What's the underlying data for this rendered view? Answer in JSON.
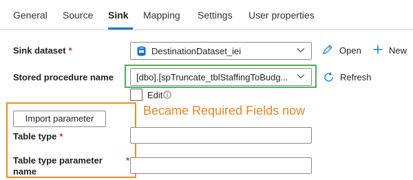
{
  "tabs": [
    {
      "label": "General"
    },
    {
      "label": "Source"
    },
    {
      "label": "Sink"
    },
    {
      "label": "Mapping"
    },
    {
      "label": "Settings"
    },
    {
      "label": "User properties"
    }
  ],
  "active_tab": "Sink",
  "sink_dataset": {
    "label": "Sink dataset",
    "required_mark": "*",
    "value": "DestinationDataset_iei",
    "open_label": "Open",
    "new_label": "New"
  },
  "stored_procedure": {
    "label": "Stored procedure name",
    "value": "[dbo].[spTruncate_tblStaffingToBudg...",
    "refresh_label": "Refresh"
  },
  "edit": {
    "label": "Edit",
    "checked": false
  },
  "annotation": {
    "text": "Became Required Fields now",
    "color": "#e8842a"
  },
  "import_parameter": {
    "label": "Import parameter"
  },
  "table_type": {
    "label": "Table type",
    "required_mark": "*",
    "value": ""
  },
  "table_type_parameter": {
    "label_line1": "Table type parameter",
    "label_line2": "name",
    "required_mark": "*",
    "value": ""
  },
  "colors": {
    "accent": "#0078d4",
    "highlight_green": "#4caf50",
    "highlight_orange": "#f08a24",
    "required": "#c4314b"
  },
  "icons": {
    "dataset": "sql-dataset-icon",
    "open": "pencil-icon",
    "new": "plus-icon",
    "refresh": "refresh-icon",
    "info": "info-icon",
    "dropdown": "chevron-down-icon"
  }
}
